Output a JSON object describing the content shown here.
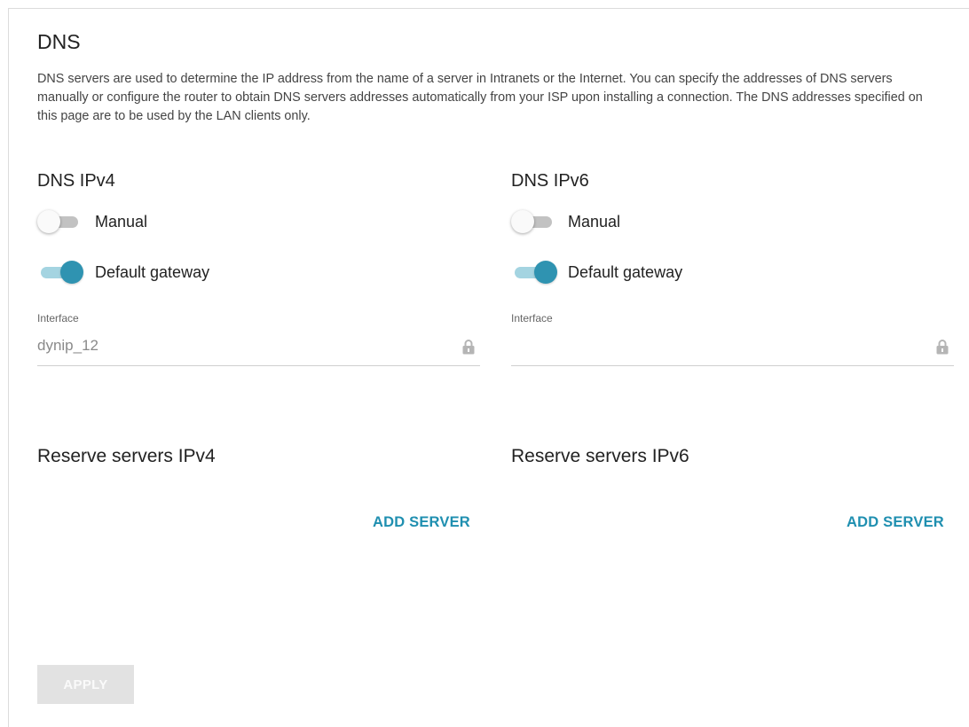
{
  "page": {
    "title": "DNS",
    "description": "DNS servers are used to determine the IP address from the name of a server in Intranets or the Internet. You can specify the addresses of DNS servers manually or configure the router to obtain DNS servers addresses automatically from your ISP upon installing a connection. The DNS addresses specified on this page are to be used by the LAN clients only."
  },
  "ipv4": {
    "title": "DNS IPv4",
    "manual": {
      "label": "Manual",
      "on": false
    },
    "default_gateway": {
      "label": "Default gateway",
      "on": true
    },
    "interface": {
      "label": "Interface",
      "value": "dynip_12",
      "icon": "lock-icon"
    },
    "reserve": {
      "title": "Reserve servers IPv4",
      "add_label": "ADD SERVER"
    }
  },
  "ipv6": {
    "title": "DNS IPv6",
    "manual": {
      "label": "Manual",
      "on": false
    },
    "default_gateway": {
      "label": "Default gateway",
      "on": true
    },
    "interface": {
      "label": "Interface",
      "value": "",
      "icon": "lock-icon"
    },
    "reserve": {
      "title": "Reserve servers IPv6",
      "add_label": "ADD SERVER"
    }
  },
  "actions": {
    "apply_label": "APPLY"
  },
  "colors": {
    "accent": "#2f93b1",
    "accent_track": "#a4d4e1",
    "link": "#1f8fb0",
    "disabled_button": "#e2e2e2"
  }
}
